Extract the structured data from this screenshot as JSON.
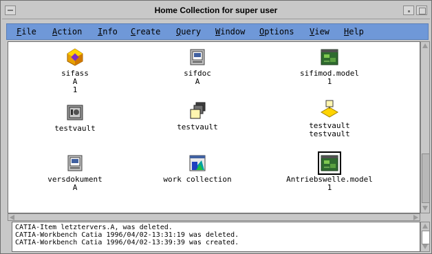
{
  "window": {
    "title": "Home Collection for super user"
  },
  "menu": [
    {
      "label": "File"
    },
    {
      "label": "Action"
    },
    {
      "label": "Info"
    },
    {
      "label": "Create"
    },
    {
      "label": "Query"
    },
    {
      "label": "Window"
    },
    {
      "label": "Options"
    },
    {
      "label": "View"
    },
    {
      "label": "Help"
    }
  ],
  "items": [
    {
      "lines": [
        "sifass",
        "A",
        "1"
      ],
      "icon": "assembly-icon"
    },
    {
      "lines": [
        "sifdoc",
        "A"
      ],
      "icon": "document-icon"
    },
    {
      "lines": [
        "sifimod.model",
        "1"
      ],
      "icon": "model-icon"
    },
    {
      "lines": [
        "testvault"
      ],
      "icon": "vault-icon"
    },
    {
      "lines": [
        "testvault"
      ],
      "icon": "folder-stack-icon"
    },
    {
      "lines": [
        "testvault",
        "testvault"
      ],
      "icon": "vault-diamond-icon"
    },
    {
      "lines": [
        "versdokument",
        "A"
      ],
      "icon": "document-icon"
    },
    {
      "lines": [
        "work collection"
      ],
      "icon": "collection-icon"
    },
    {
      "lines": [
        "Antriebswelle.model",
        "1"
      ],
      "icon": "model-icon"
    }
  ],
  "log": [
    "CATIA-Item letztervers.A, was deleted.",
    "CATIA-Workbench Catia 1996/04/02-13:31:19 was deleted.",
    "CATIA-Workbench Catia 1996/04/02-13:39:39 was created."
  ],
  "colors": {
    "menubar": "#6f98d8",
    "accent_yellow": "#ffd400",
    "model_green": "#2f6b2f"
  }
}
